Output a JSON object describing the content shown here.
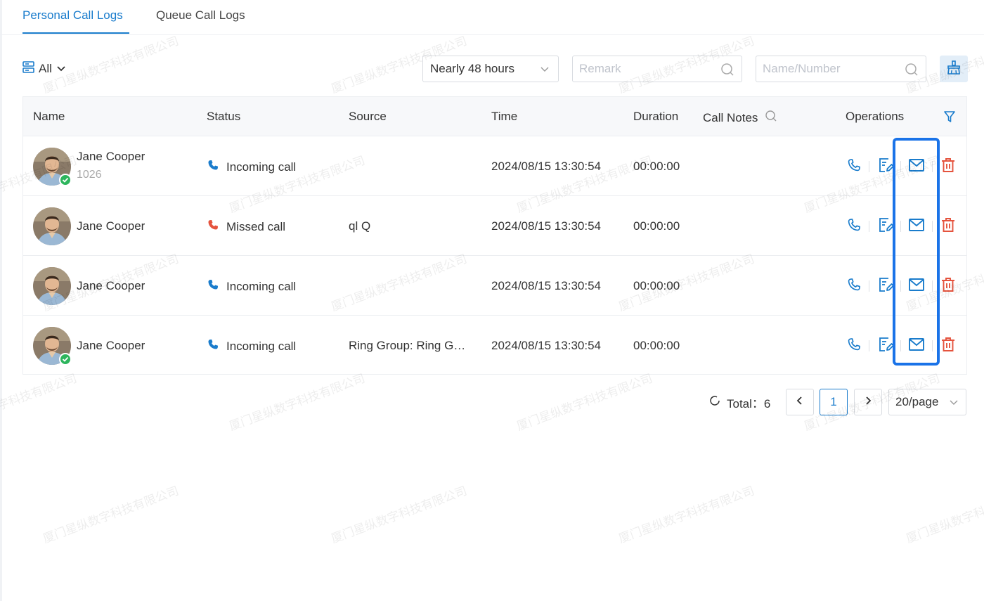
{
  "tabs": [
    {
      "label": "Personal Call Logs",
      "active": true
    },
    {
      "label": "Queue Call Logs",
      "active": false
    }
  ],
  "toolbar": {
    "filter_label": "All",
    "time_range": "Nearly 48 hours",
    "remark_placeholder": "Remark",
    "name_placeholder": "Name/Number"
  },
  "table": {
    "headers": {
      "name": "Name",
      "status": "Status",
      "source": "Source",
      "time": "Time",
      "duration": "Duration",
      "notes": "Call Notes",
      "operations": "Operations"
    },
    "rows": [
      {
        "name": "Jane Cooper",
        "number": "1026",
        "online": true,
        "status": "Incoming call",
        "status_type": "incoming",
        "source": "",
        "time": "2024/08/15 13:30:54",
        "duration": "00:00:00",
        "notes": ""
      },
      {
        "name": "Jane Cooper",
        "number": "",
        "online": false,
        "status": "Missed call",
        "status_type": "missed",
        "source": "ql Q",
        "time": "2024/08/15 13:30:54",
        "duration": "00:00:00",
        "notes": ""
      },
      {
        "name": "Jane Cooper",
        "number": "",
        "online": false,
        "status": "Incoming call",
        "status_type": "incoming",
        "source": "",
        "time": "2024/08/15 13:30:54",
        "duration": "00:00:00",
        "notes": ""
      },
      {
        "name": "Jane Cooper",
        "number": "",
        "online": true,
        "status": "Incoming call",
        "status_type": "incoming",
        "source": "Ring Group: Ring G…",
        "time": "2024/08/15 13:30:54",
        "duration": "00:00:00",
        "notes": ""
      }
    ]
  },
  "pagination": {
    "total_label": "Total：6",
    "current_page": "1",
    "page_size": "20/page"
  },
  "watermark_text": "厦门星纵数字科技有限公司",
  "colors": {
    "accent": "#1a7ccc",
    "missed": "#e5533d",
    "delete": "#e5533d",
    "online": "#2db55d",
    "highlight": "#1a73e8"
  }
}
